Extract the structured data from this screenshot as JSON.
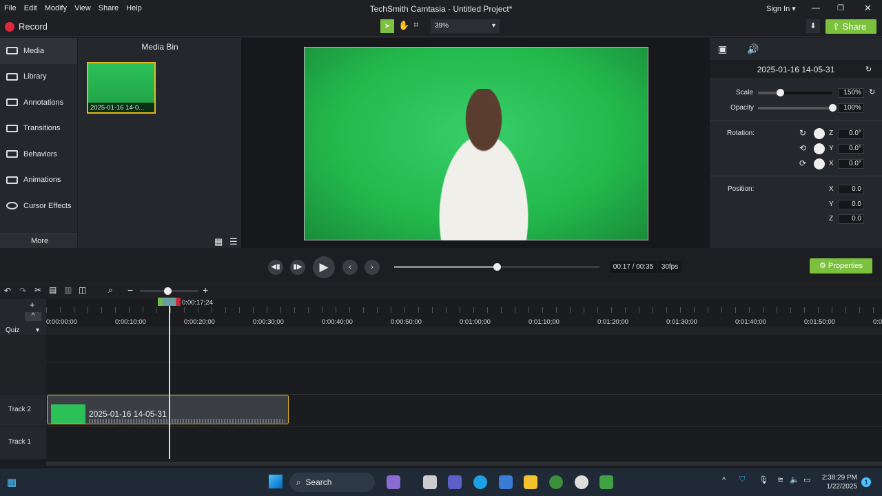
{
  "menu": [
    "File",
    "Edit",
    "Modify",
    "View",
    "Share",
    "Help"
  ],
  "window_title": "TechSmith Camtasia - Untitled Project*",
  "sign_in": "Sign In",
  "toolbar": {
    "record": "Record",
    "zoom": "39%",
    "share": "Share"
  },
  "nav": [
    "Media",
    "Library",
    "Annotations",
    "Transitions",
    "Behaviors",
    "Animations",
    "Cursor Effects"
  ],
  "nav_more": "More",
  "media_bin": {
    "title": "Media Bin",
    "items": [
      "2025-01-16 14-0..."
    ]
  },
  "properties": {
    "clip_name": "2025-01-16 14-05-31",
    "scale_label": "Scale",
    "scale": "150%",
    "scale_fraction": 0.3,
    "opacity_label": "Opacity",
    "opacity": "100%",
    "opacity_fraction": 1.0,
    "rotation_label": "Rotation:",
    "rot_z": "0.0°",
    "rot_y": "0.0°",
    "rot_x": "0.0°",
    "axes": [
      "Z",
      "Y",
      "X"
    ],
    "position_label": "Position:",
    "pos_x": "0.0",
    "pos_y": "0.0",
    "pos_z": "0.0",
    "pos_axes": [
      "X",
      "Y",
      "Z"
    ]
  },
  "playback": {
    "time": "00:17 / 00:35",
    "fps": "30fps",
    "progress": 0.5,
    "properties_button": "Properties"
  },
  "timeline": {
    "playhead": "0:00:17;24",
    "ticks": [
      "0:00:00;00",
      "0:00:10;00",
      "0:00:20;00",
      "0:00:30;00",
      "0:00:40;00",
      "0:00:50;00",
      "0:01:00;00",
      "0:01:10;00",
      "0:01:20;00",
      "0:01:30;00",
      "0:01:40;00",
      "0:01:50;00",
      "0:0"
    ],
    "quiz": "Quiz",
    "tracks": [
      "Track 2",
      "Track 1"
    ],
    "clip": "2025-01-16 14-05-31"
  },
  "taskbar": {
    "search": "Search",
    "time": "2:38:29 PM",
    "date": "1/22/2025",
    "badge": "1"
  }
}
